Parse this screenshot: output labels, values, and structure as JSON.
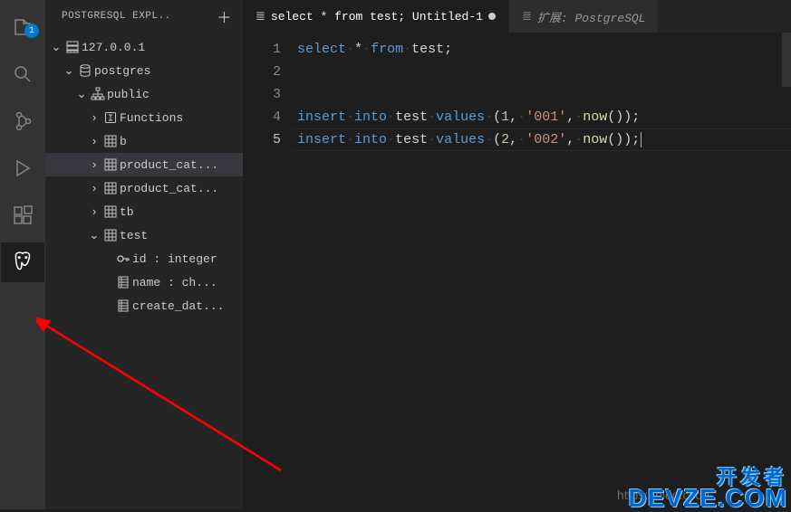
{
  "activityBar": {
    "explorerBadge": "1"
  },
  "sidebar": {
    "title": "POSTGRESQL EXPL..",
    "tree": {
      "host": "127.0.0.1",
      "database": "postgres",
      "schema": "public",
      "nodes": [
        {
          "label": "Functions",
          "type": "functions"
        },
        {
          "label": "b",
          "type": "table"
        },
        {
          "label": "product_cat...",
          "type": "table",
          "selected": true
        },
        {
          "label": "product_cat...",
          "type": "table"
        },
        {
          "label": "tb",
          "type": "table"
        },
        {
          "label": "test",
          "type": "table",
          "expanded": true
        }
      ],
      "columns": [
        {
          "label": "id : integer",
          "icon": "key"
        },
        {
          "label": "name : ch...",
          "icon": "column"
        },
        {
          "label": "create_dat...",
          "icon": "column"
        }
      ]
    }
  },
  "tabs": {
    "tab1Label": "select * from test; Untitled-1",
    "tab2Label": "扩展: PostgreSQL"
  },
  "editor": {
    "lines": [
      "1",
      "2",
      "3",
      "4",
      "5"
    ],
    "line1": {
      "t1": "select",
      "t2": "*",
      "t3": "from",
      "t4": "test",
      "t5": ";"
    },
    "line4": {
      "t1": "insert",
      "t2": "into",
      "t3": "test",
      "t4": "values",
      "t5": "(",
      "t6": "1",
      "t7": ",",
      "t8": "'001'",
      "t9": ",",
      "t10": "now",
      "t11": "());"
    },
    "line5": {
      "t1": "insert",
      "t2": "into",
      "t3": "test",
      "t4": "values",
      "t5": "(",
      "t6": "2",
      "t7": ",",
      "t8": "'002'",
      "t9": ",",
      "t10": "now",
      "t11": "());"
    }
  },
  "watermark": "https://blog.csdn",
  "brand": {
    "top": "开发者",
    "bottom": "DEVZE.COM"
  }
}
